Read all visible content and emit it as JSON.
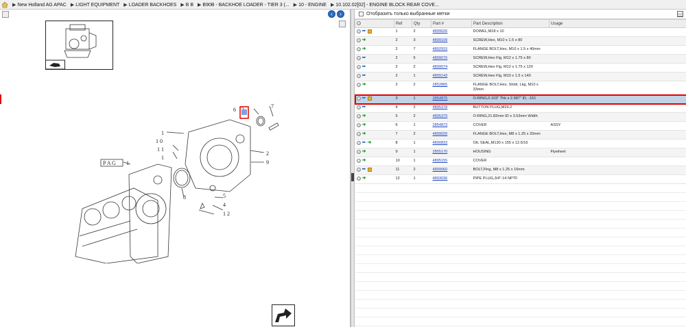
{
  "breadcrumb": [
    "New Holland AG APAC",
    "LIGHT EQUIPMENT",
    "LOADER BACKHOES",
    "B B",
    "B90B - BACKHOE LOADER - TIER 3 (...",
    "10 - ENGINE",
    "10.102.02[02] - ENGINE BLOCK REAR COVE..."
  ],
  "filter": {
    "label": "Отобразить только выбранные метки"
  },
  "columns": {
    "ref": "Ref",
    "qty": "Qty",
    "part": "Part #",
    "desc": "Part Description",
    "usage": "Usage"
  },
  "rows": [
    {
      "ref": "1",
      "qty": "2",
      "part": "4899026",
      "desc": "DOWEL,M18 x 10",
      "usage": "",
      "icons": [
        "gray",
        "blue",
        "box"
      ]
    },
    {
      "ref": "2",
      "qty": "3",
      "part": "4899109",
      "desc": "SCREW,Hex, M10 x 1.5 x 80",
      "usage": "",
      "icons": [
        "gray",
        "green"
      ]
    },
    {
      "ref": "2",
      "qty": "7",
      "part": "4892915",
      "desc": "FLANGE BOLT,Hex, M10 x 1.5 x 40mm",
      "usage": "",
      "icons": [
        "gray",
        "green"
      ]
    },
    {
      "ref": "2",
      "qty": "5",
      "part": "4899076",
      "desc": "SCREW,Hex Flg, M12 x 1.75 x 80",
      "usage": "",
      "icons": [
        "gray",
        "blue"
      ]
    },
    {
      "ref": "2",
      "qty": "2",
      "part": "4899074",
      "desc": "SCREW,Hex Flg, M12 x 1.75 x 120",
      "usage": "",
      "icons": [
        "gray",
        "blue"
      ]
    },
    {
      "ref": "2",
      "qty": "1",
      "part": "4899143",
      "desc": "SCREW,Hex Flg, M10 x 1.5 x 140",
      "usage": "",
      "icons": [
        "gray",
        "blue"
      ]
    },
    {
      "ref": "2",
      "qty": "2",
      "part": "2852865",
      "desc": "FLANGE BOLT,Hex, Shldr, Lkg, M10 x 33mm",
      "usage": "",
      "icons": [
        "gray",
        "green"
      ],
      "tall": true
    },
    {
      "ref": "3",
      "qty": "1",
      "part": "2854875",
      "desc": "O-RING,0.103\" Thk x 2.987\" ID, -151",
      "usage": "",
      "icons": [
        "gray",
        "blue",
        "box"
      ],
      "selected": true
    },
    {
      "ref": "4",
      "qty": "2",
      "part": "4895378",
      "desc": "BUTTON PLUG,M29.2",
      "usage": "",
      "icons": [
        "gray",
        "blue"
      ]
    },
    {
      "ref": "5",
      "qty": "2",
      "part": "4895379",
      "desc": "O-RING,21.82mm ID x 3.53mm Width",
      "usage": "",
      "icons": [
        "gray",
        "green"
      ]
    },
    {
      "ref": "6",
      "qty": "1",
      "part": "2854873",
      "desc": "COVER",
      "usage": "ASSY",
      "icons": [
        "gray",
        "green"
      ]
    },
    {
      "ref": "7",
      "qty": "2",
      "part": "4899020",
      "desc": "FLANGE BOLT,Hex, M8 x 1.25 x 20mm",
      "usage": "",
      "icons": [
        "gray",
        "green"
      ]
    },
    {
      "ref": "8",
      "qty": "1",
      "part": "4890833",
      "desc": "OIL SEAL,M130 x 155 x 12.5/16",
      "usage": "",
      "icons": [
        "gray",
        "blue",
        "green"
      ]
    },
    {
      "ref": "9",
      "qty": "1",
      "part": "2855170",
      "desc": "HOUSING",
      "usage": "Flywheel",
      "icons": [
        "gray",
        "green"
      ]
    },
    {
      "ref": "10",
      "qty": "1",
      "part": "4895155",
      "desc": "COVER",
      "usage": "",
      "icons": [
        "gray",
        "green"
      ]
    },
    {
      "ref": "11",
      "qty": "2",
      "part": "4899060",
      "desc": "BOLT,Flng, M8 x 1.25 x 16mm",
      "usage": "",
      "icons": [
        "gray",
        "blue",
        "box"
      ]
    },
    {
      "ref": "12",
      "qty": "1",
      "part": "4893036",
      "desc": "PIPE PLUG,3/4\"-14 NPTF",
      "usage": "",
      "icons": [
        "gray",
        "green"
      ]
    }
  ],
  "diagram": {
    "callouts": [
      "1",
      "1 0",
      "1 1",
      "2",
      "3",
      "4",
      "5",
      "6",
      "7",
      "8",
      "9",
      "1 2",
      "1",
      "1"
    ],
    "pag_label": "P A G"
  }
}
